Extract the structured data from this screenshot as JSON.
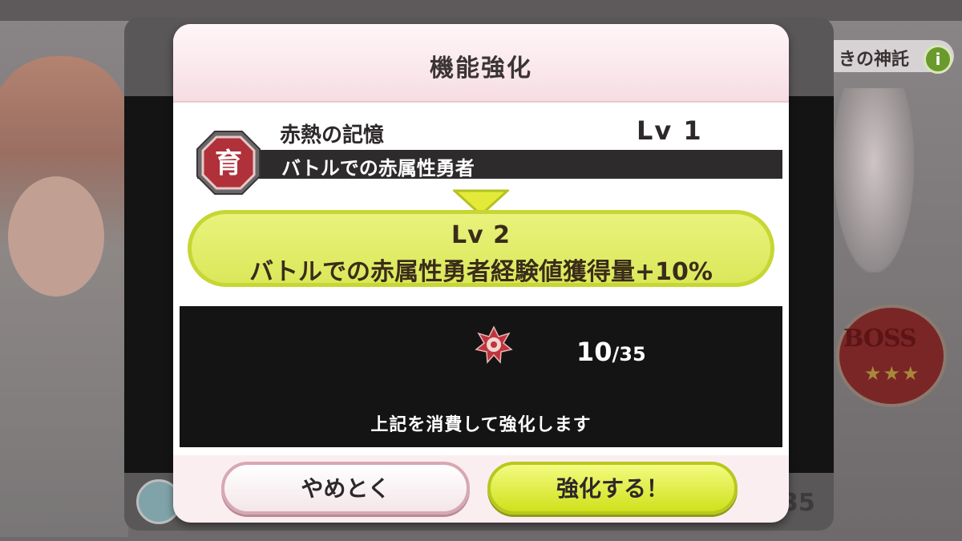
{
  "background": {
    "right_title_fragment": "きの神託",
    "info_glyph": "i",
    "boss_label": "BOSS",
    "boss_stars": "★★★",
    "bottom_number": "35"
  },
  "dialog": {
    "title": "機能強化",
    "skill": {
      "badge_glyph": "育",
      "name": "赤熱の記憶",
      "level": "Lv 1",
      "description": "バトルでの赤属性勇者"
    },
    "next": {
      "level": "Lv 2",
      "description": "バトルでの赤属性勇者経験値獲得量+10%"
    },
    "cost": {
      "owned": "10",
      "required": "/35",
      "note": "上記を消費して強化します"
    },
    "buttons": {
      "cancel": "やめとく",
      "confirm": "強化する！"
    }
  },
  "colors": {
    "accent_green": "#dbe85a",
    "dialog_pink": "#fbeef1",
    "badge_red": "#b0313a"
  }
}
